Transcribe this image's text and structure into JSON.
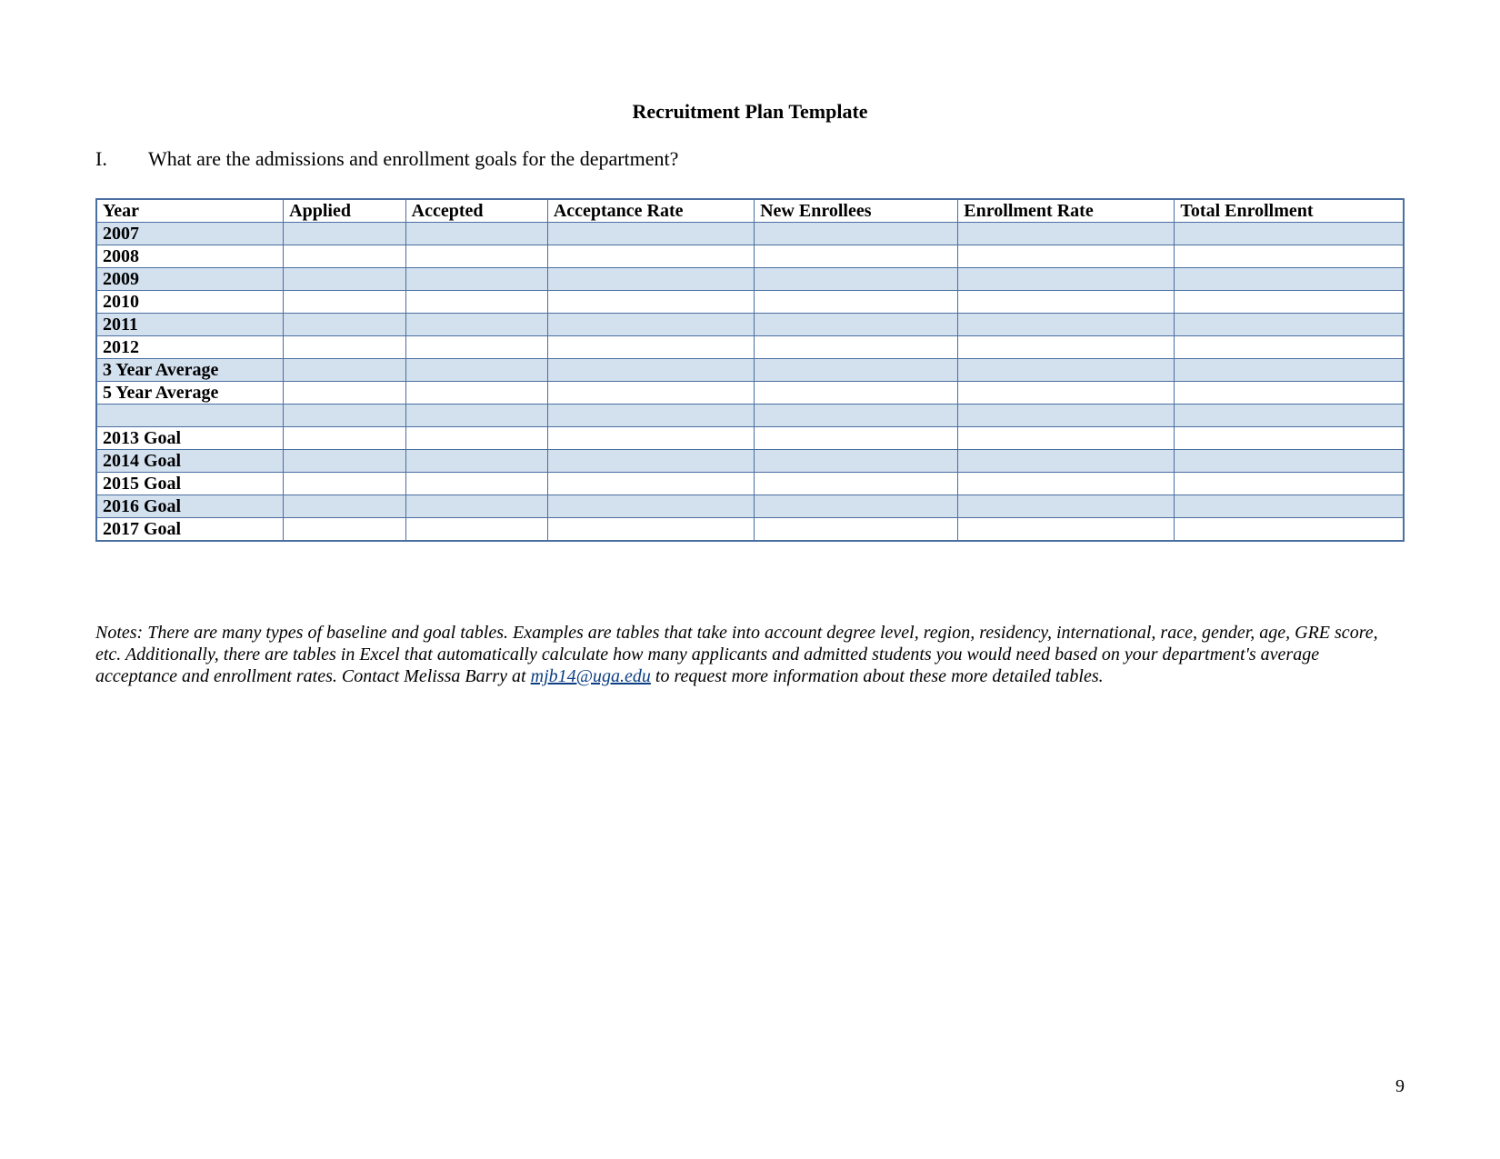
{
  "title": "Recruitment Plan Template",
  "section": {
    "number": "I.",
    "text": "What are the admissions and enrollment goals for the department?"
  },
  "table": {
    "headers": [
      "Year",
      "Applied",
      "Accepted",
      "Acceptance Rate",
      "New Enrollees",
      "Enrollment Rate",
      "Total Enrollment"
    ],
    "rows": [
      {
        "label": "2007",
        "shaded": true,
        "cells": [
          "",
          "",
          "",
          "",
          "",
          ""
        ]
      },
      {
        "label": "2008",
        "shaded": false,
        "cells": [
          "",
          "",
          "",
          "",
          "",
          ""
        ]
      },
      {
        "label": "2009",
        "shaded": true,
        "cells": [
          "",
          "",
          "",
          "",
          "",
          ""
        ]
      },
      {
        "label": "2010",
        "shaded": false,
        "cells": [
          "",
          "",
          "",
          "",
          "",
          ""
        ]
      },
      {
        "label": "2011",
        "shaded": true,
        "cells": [
          "",
          "",
          "",
          "",
          "",
          ""
        ]
      },
      {
        "label": "2012",
        "shaded": false,
        "cells": [
          "",
          "",
          "",
          "",
          "",
          ""
        ]
      },
      {
        "label": "3 Year Average",
        "shaded": true,
        "cells": [
          "",
          "",
          "",
          "",
          "",
          ""
        ]
      },
      {
        "label": "5 Year Average",
        "shaded": false,
        "cells": [
          "",
          "",
          "",
          "",
          "",
          ""
        ]
      },
      {
        "label": "",
        "shaded": true,
        "cells": [
          "",
          "",
          "",
          "",
          "",
          ""
        ]
      },
      {
        "label": "2013 Goal",
        "shaded": false,
        "cells": [
          "",
          "",
          "",
          "",
          "",
          ""
        ]
      },
      {
        "label": "2014 Goal",
        "shaded": true,
        "cells": [
          "",
          "",
          "",
          "",
          "",
          ""
        ]
      },
      {
        "label": "2015 Goal",
        "shaded": false,
        "cells": [
          "",
          "",
          "",
          "",
          "",
          ""
        ]
      },
      {
        "label": "2016 Goal",
        "shaded": true,
        "cells": [
          "",
          "",
          "",
          "",
          "",
          ""
        ]
      },
      {
        "label": "2017 Goal",
        "shaded": false,
        "cells": [
          "",
          "",
          "",
          "",
          "",
          ""
        ]
      }
    ]
  },
  "notes": {
    "pre": "Notes: There are many types of baseline and goal tables. Examples are tables that take into account degree level, region, residency, international, race, gender, age, GRE score, etc. Additionally, there are tables in Excel that automatically calculate how many applicants and admitted students you would need based on your department's average acceptance and enrollment rates. Contact Melissa Barry at ",
    "link_text": "mjb14@uga.edu",
    "link_href": "mailto:mjb14@uga.edu",
    "post": " to request more information about these more detailed tables."
  },
  "page_number": "9"
}
